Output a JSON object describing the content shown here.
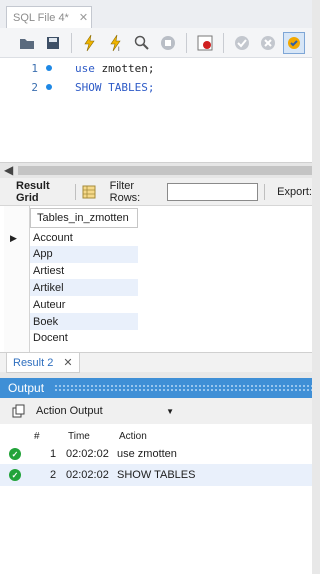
{
  "editor_tab": {
    "title": "SQL File 4*",
    "close": "✕"
  },
  "editor": {
    "lines": [
      {
        "num": "1",
        "kw": "use",
        "rest": " zmotten;"
      },
      {
        "num": "2",
        "kw": "SHOW TABLES;",
        "rest": ""
      }
    ]
  },
  "grid_toolbar": {
    "result_grid": "Result Grid",
    "filter_rows": "Filter Rows:",
    "export": "Export:"
  },
  "grid": {
    "column": "Tables_in_zmotten",
    "rows": [
      "Account",
      "App",
      "Artiest",
      "Artikel",
      "Auteur",
      "Boek",
      "Docent"
    ]
  },
  "result_tab": {
    "label": "Result 2",
    "close": "✕"
  },
  "output": {
    "title": "Output",
    "selector": "Action Output",
    "headers": {
      "num": "#",
      "time": "Time",
      "action": "Action"
    },
    "rows": [
      {
        "num": "1",
        "time": "02:02:02",
        "action": "use zmotten"
      },
      {
        "num": "2",
        "time": "02:02:02",
        "action": "SHOW TABLES"
      }
    ]
  },
  "colors": {
    "accent": "#3f8fd6",
    "ok": "#22a33a",
    "keyword": "#2e5bc7"
  }
}
